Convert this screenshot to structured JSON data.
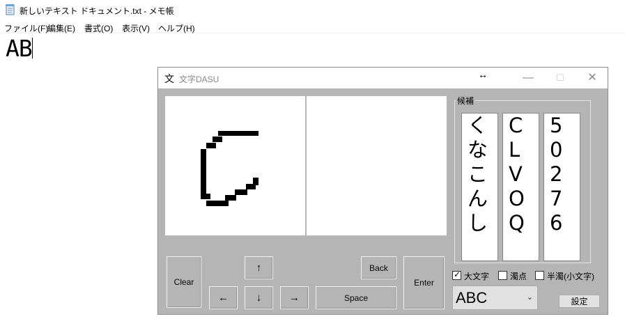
{
  "notepad": {
    "title": "新しいテキスト ドキュメント.txt - メモ帳",
    "menu": [
      "ファイル(F)",
      "編集(E)",
      "書式(O)",
      "表示(V)",
      "ヘルプ(H)"
    ],
    "text": "AB"
  },
  "dasu": {
    "icon_glyph": "文",
    "title": "文字DASU",
    "resize_glyph": "↔",
    "window_buttons": {
      "minimize": "—",
      "maximize": "☐",
      "close": "✕"
    },
    "candidates": {
      "label": "候補",
      "columns": [
        [
          "く",
          "な",
          "こ",
          "ん",
          "し"
        ],
        [
          "C",
          "L",
          "V",
          "O",
          "Q"
        ],
        [
          "5",
          "0",
          "2",
          "7",
          "6"
        ]
      ]
    },
    "buttons": {
      "clear": "Clear",
      "up": "↑",
      "left": "←",
      "down": "↓",
      "right": "→",
      "back": "Back",
      "space": "Space",
      "enter": "Enter",
      "settings": "設定"
    },
    "options": [
      {
        "label": "大文字",
        "checked": true
      },
      {
        "label": "濁点",
        "checked": false
      },
      {
        "label": "半濁(小文字)",
        "checked": false
      }
    ],
    "check_glyph": "✓",
    "mode_select": {
      "value": "ABC",
      "arrow": "⌄"
    },
    "colors": {
      "window_bg": "#b5b5b5",
      "canvas": "#ffffff",
      "stroke": "#000000"
    }
  }
}
